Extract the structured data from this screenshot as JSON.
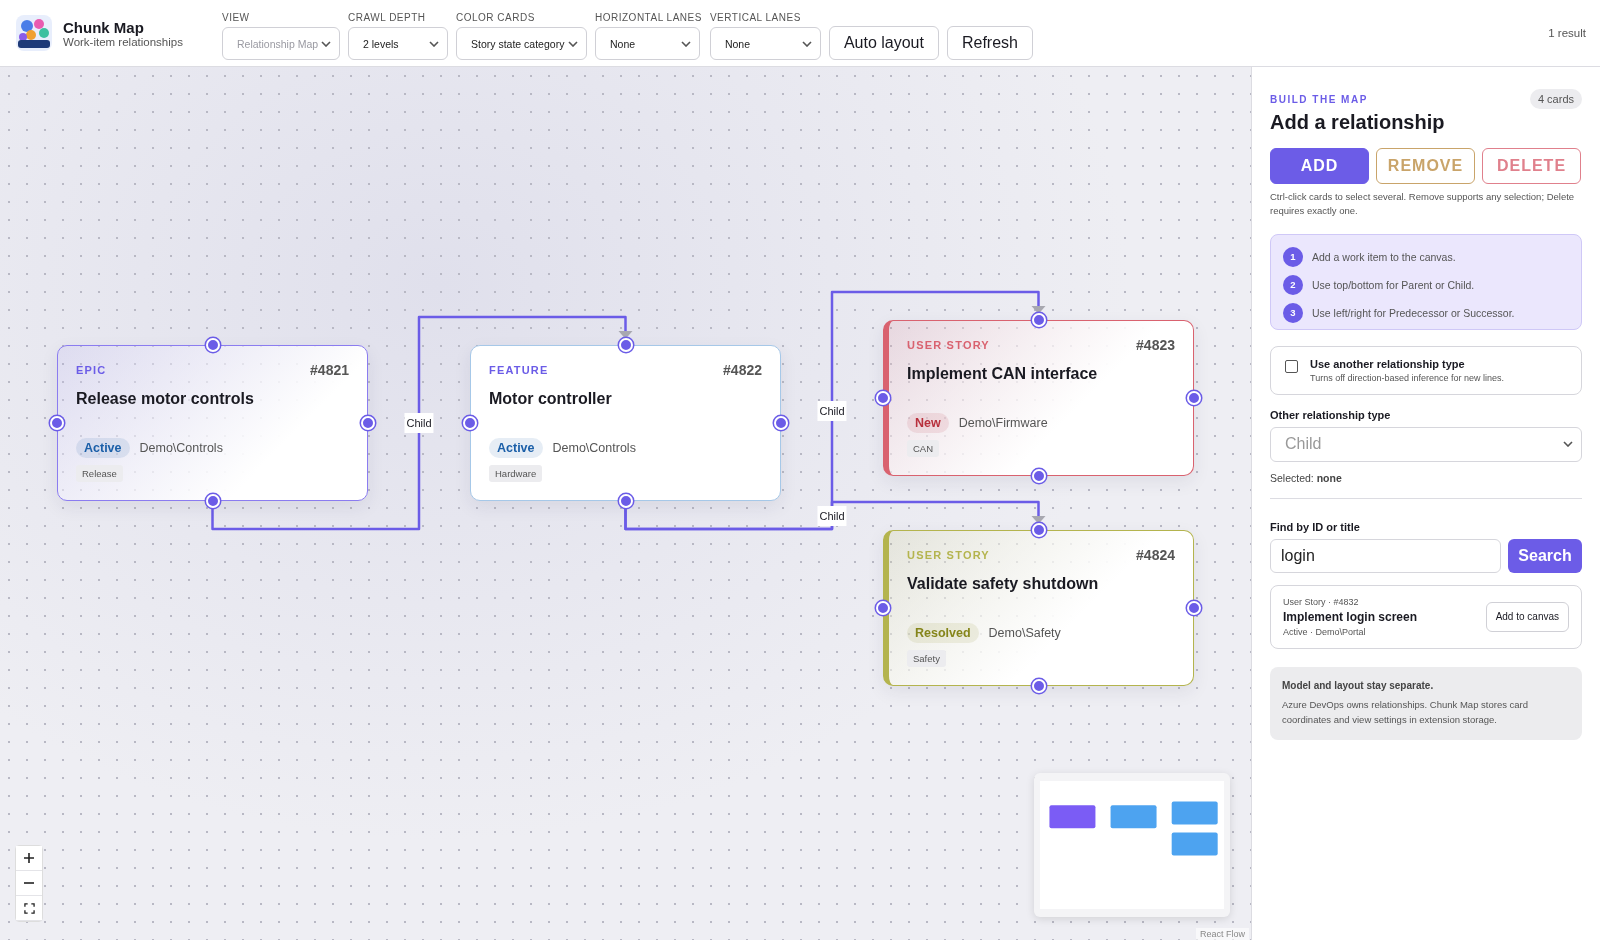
{
  "app": {
    "title": "Chunk Map",
    "subtitle": "Work-item relationships"
  },
  "toolbar": {
    "selects": [
      {
        "label": "VIEW",
        "value": "Relationship Map",
        "disabled": true
      },
      {
        "label": "CRAWL DEPTH",
        "value": "2 levels",
        "disabled": false
      },
      {
        "label": "COLOR CARDS",
        "value": "Story state category",
        "disabled": false
      },
      {
        "label": "HORIZONTAL LANES",
        "value": "None",
        "disabled": false
      },
      {
        "label": "VERTICAL LANES",
        "value": "None",
        "disabled": false
      }
    ],
    "buttons": [
      "Auto layout",
      "Refresh"
    ],
    "result_count": "1 result"
  },
  "cards": [
    {
      "kind": "epic",
      "type": "EPIC",
      "id": "#4821",
      "title": "Release motor controls",
      "state": {
        "label": "Active",
        "color": "#1b5fa8"
      },
      "area": "Demo\\Controls",
      "tag": "Release",
      "color": "#8b7cf0"
    },
    {
      "kind": "feature",
      "type": "FEATURE",
      "id": "#4822",
      "title": "Motor controller",
      "state": {
        "label": "Active",
        "color": "#1b5fa8"
      },
      "area": "Demo\\Controls",
      "tag": "Hardware",
      "color": "#a6c8e8"
    },
    {
      "kind": "story",
      "type": "USER STORY",
      "id": "#4823",
      "title": "Implement CAN interface",
      "state": {
        "label": "New",
        "color": "#b8303c"
      },
      "area": "Demo\\Firmware",
      "tag": "CAN",
      "color": "#d9626f"
    },
    {
      "kind": "story",
      "type": "USER STORY",
      "id": "#4824",
      "title": "Validate safety shutdown",
      "state": {
        "label": "Resolved",
        "color": "#85851a"
      },
      "area": "Demo\\Safety",
      "tag": "Safety",
      "color": "#b4b44e"
    }
  ],
  "edges": [
    {
      "label": "Child"
    },
    {
      "label": "Child"
    },
    {
      "label": "Child"
    }
  ],
  "attribution": "React Flow",
  "sidebar": {
    "eyebrow": "BUILD THE MAP",
    "card_count": "4 cards",
    "title": "Add a relationship",
    "modes": [
      {
        "label": "ADD",
        "selected": true,
        "disabled": false,
        "color": "#6c5ce7"
      },
      {
        "label": "REMOVE",
        "selected": false,
        "disabled": true,
        "color": "#c9a46a"
      },
      {
        "label": "DELETE",
        "selected": false,
        "disabled": true,
        "color": "#e0808c"
      }
    ],
    "help": "Ctrl-click cards to select several. Remove supports any selection; Delete requires exactly one.",
    "steps": [
      {
        "number": "1",
        "text": "Add a work item to the canvas."
      },
      {
        "number": "2",
        "text": "Use top/bottom for Parent or Child."
      },
      {
        "number": "3",
        "text": "Use left/right for Predecessor or Successor."
      }
    ],
    "override": {
      "label": "Use another relationship type",
      "hint": "Turns off direction-based inference for new lines.",
      "checked": false
    },
    "type_select": {
      "label": "Other relationship type",
      "value": "Child",
      "disabled": true
    },
    "selected_text": "Selected: **none**",
    "find": {
      "label": "Find by ID or title",
      "value": "login",
      "button": "Search"
    },
    "results": [
      {
        "meta": "User Story · #4832",
        "title": "Implement login screen",
        "detail": "Active · Demo\\Portal",
        "button": "Add to canvas"
      }
    ],
    "note": {
      "title": "Model and layout stay separate.",
      "text": "Azure DevOps owns relationships. Chunk Map stores card coordinates and view settings in extension storage."
    }
  }
}
